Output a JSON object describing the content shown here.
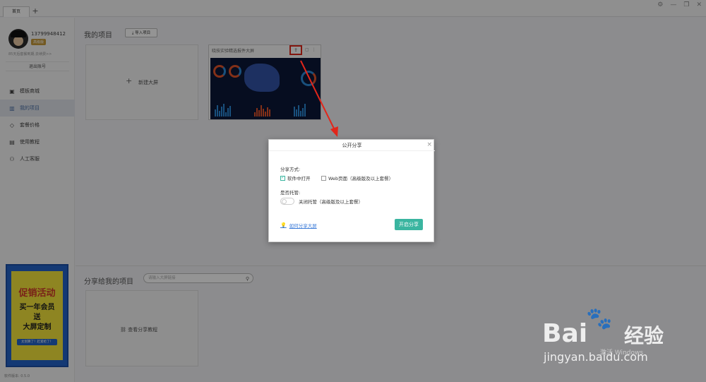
{
  "tabs": {
    "home": "首页",
    "add": "+"
  },
  "window_controls": [
    "⚙",
    "—",
    "❐",
    "✕"
  ],
  "user": {
    "phone": "13799948412",
    "vip_label": "高级版",
    "expire_note": "85天后套餐到期,去续费>>",
    "logout": "退出账号"
  },
  "nav": [
    {
      "icon": "template-icon",
      "label": "模板商城",
      "glyph": "▣"
    },
    {
      "icon": "chart-icon",
      "label": "我的项目",
      "glyph": "▥"
    },
    {
      "icon": "tag-icon",
      "label": "套餐价格",
      "glyph": "◇"
    },
    {
      "icon": "book-icon",
      "label": "使用教程",
      "glyph": "▤"
    },
    {
      "icon": "user-icon",
      "label": "人工客服",
      "glyph": "⚇"
    }
  ],
  "promo": {
    "line1": "促销活动",
    "line2": "买一年会员",
    "line3": "送",
    "line4": "大屏定制",
    "button": "太划算了！赶紧抢了！"
  },
  "version": "软件版本: 0.5.0",
  "my_projects": {
    "title": "我的项目",
    "import_btn": "导入项目",
    "new_screen": "新建大屏",
    "project_name": "晓技实验精选报件大屏"
  },
  "shared": {
    "title": "分享给我的项目",
    "search_placeholder": "请输入大屏链接",
    "tutorial": "查看分享教程"
  },
  "modal": {
    "title": "公开分享",
    "method_label": "分享方式:",
    "opt_software": "软件中打开",
    "opt_web": "Web页面（高级版及以上套餐）",
    "host_label": "是否托管:",
    "toggle_label": "关闭托管（高级版及以上套餐）",
    "help_link": "如何分享大屏",
    "start_btn": "开启分享"
  },
  "watermark": {
    "brand": "Bai",
    "cn": "经验",
    "url": "jingyan.baidu.com",
    "win": "激活 Windows"
  },
  "colors": {
    "accent": "#3ab5a0",
    "highlight": "#e2261a",
    "link": "#3b7bd8"
  }
}
